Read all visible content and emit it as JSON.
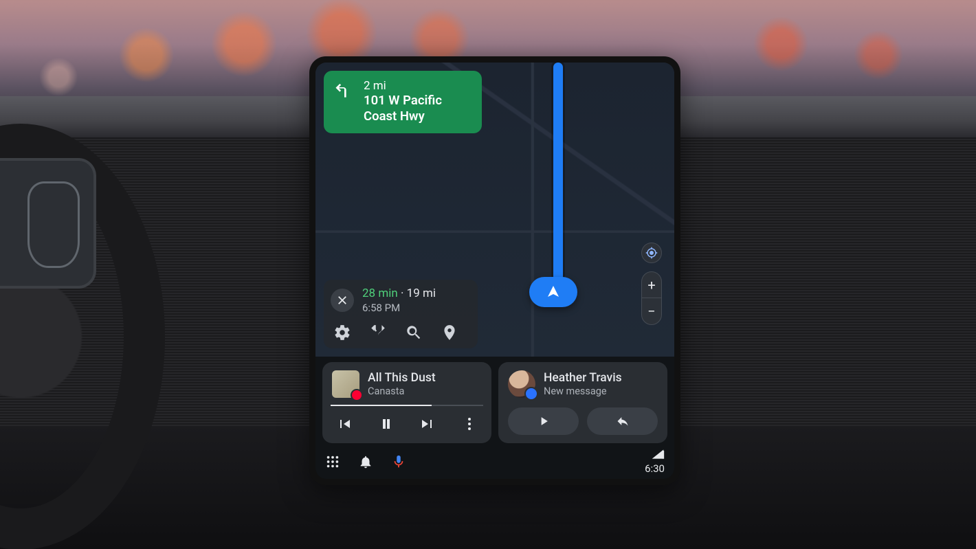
{
  "navigation": {
    "turn_distance": "2 mi",
    "turn_road": "101 W Pacific Coast Hwy",
    "eta_minutes": "28 min",
    "eta_separator": " · ",
    "remaining_distance": "19 mi",
    "arrival_time": "6:58 PM"
  },
  "media": {
    "track_title": "All This Dust",
    "artist": "Canasta"
  },
  "message": {
    "sender": "Heather Travis",
    "status": "New message"
  },
  "status_bar": {
    "time": "6:30"
  }
}
